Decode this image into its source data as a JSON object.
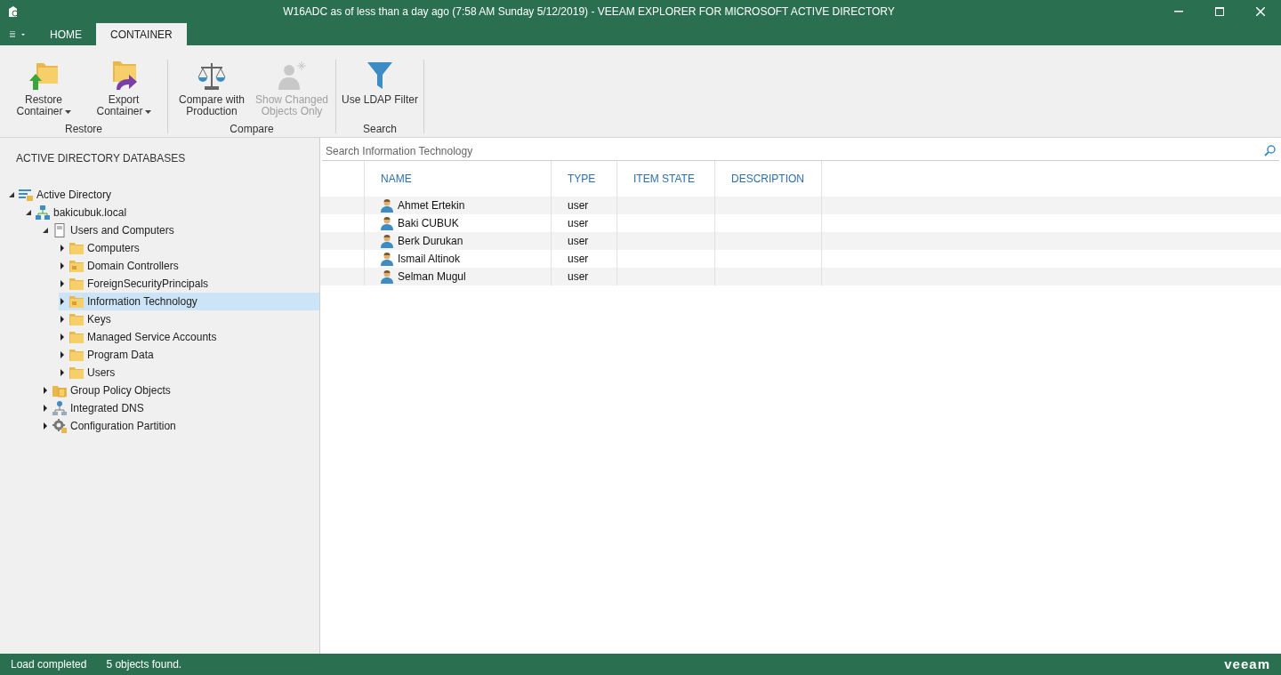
{
  "window": {
    "title": "W16ADC as of less than a day ago (7:58 AM Sunday 5/12/2019) - VEEAM EXPLORER FOR MICROSOFT ACTIVE DIRECTORY"
  },
  "tabs": [
    {
      "label": "HOME",
      "selected": false
    },
    {
      "label": "CONTAINER",
      "selected": true
    }
  ],
  "ribbon": {
    "groups": [
      {
        "label": "Restore",
        "buttons": [
          {
            "kind": "restore",
            "label": "Restore Container",
            "dropdown": true,
            "disabled": false
          },
          {
            "kind": "export",
            "label": "Export Container",
            "dropdown": true,
            "disabled": false
          }
        ]
      },
      {
        "label": "Compare",
        "buttons": [
          {
            "kind": "compare",
            "label": "Compare with Production",
            "dropdown": false,
            "disabled": false
          },
          {
            "kind": "changed",
            "label": "Show Changed Objects Only",
            "dropdown": false,
            "disabled": true
          }
        ]
      },
      {
        "label": "Search",
        "buttons": [
          {
            "kind": "filter",
            "label": "Use LDAP Filter",
            "dropdown": false,
            "disabled": false
          }
        ]
      }
    ]
  },
  "sidebar": {
    "title": "ACTIVE DIRECTORY DATABASES",
    "tree": [
      {
        "label": "Active Directory",
        "kind": "directory",
        "expanded": true,
        "selected": false,
        "children": [
          {
            "label": "bakicubuk.local",
            "kind": "domain",
            "expanded": true,
            "selected": false,
            "children": [
              {
                "label": "Users and Computers",
                "kind": "server",
                "expanded": true,
                "selected": false,
                "children": [
                  {
                    "label": "Computers",
                    "kind": "folder",
                    "expanded": false,
                    "selected": false
                  },
                  {
                    "label": "Domain Controllers",
                    "kind": "ou",
                    "expanded": false,
                    "selected": false
                  },
                  {
                    "label": "ForeignSecurityPrincipals",
                    "kind": "folder",
                    "expanded": false,
                    "selected": false
                  },
                  {
                    "label": "Information Technology",
                    "kind": "ou",
                    "expanded": false,
                    "selected": true
                  },
                  {
                    "label": "Keys",
                    "kind": "folder",
                    "expanded": false,
                    "selected": false
                  },
                  {
                    "label": "Managed Service Accounts",
                    "kind": "folder",
                    "expanded": false,
                    "selected": false
                  },
                  {
                    "label": "Program Data",
                    "kind": "folder",
                    "expanded": false,
                    "selected": false
                  },
                  {
                    "label": "Users",
                    "kind": "folder",
                    "expanded": false,
                    "selected": false
                  }
                ]
              },
              {
                "label": "Group Policy Objects",
                "kind": "gpo",
                "expanded": false,
                "selected": false
              },
              {
                "label": "Integrated DNS",
                "kind": "dns",
                "expanded": false,
                "selected": false
              },
              {
                "label": "Configuration Partition",
                "kind": "config",
                "expanded": false,
                "selected": false
              }
            ]
          }
        ]
      }
    ]
  },
  "search": {
    "placeholder": "Search Information Technology"
  },
  "table": {
    "columns": [
      "NAME",
      "TYPE",
      "ITEM STATE",
      "DESCRIPTION"
    ],
    "rows": [
      {
        "name": "Ahmet Ertekin",
        "type": "user"
      },
      {
        "name": "Baki CUBUK",
        "type": "user"
      },
      {
        "name": "Berk Durukan",
        "type": "user"
      },
      {
        "name": "Ismail Altinok",
        "type": "user"
      },
      {
        "name": "Selman Mugul",
        "type": "user"
      }
    ]
  },
  "status_bar": {
    "status": "Load completed",
    "count": "5 objects found.",
    "logo": "veeam"
  }
}
